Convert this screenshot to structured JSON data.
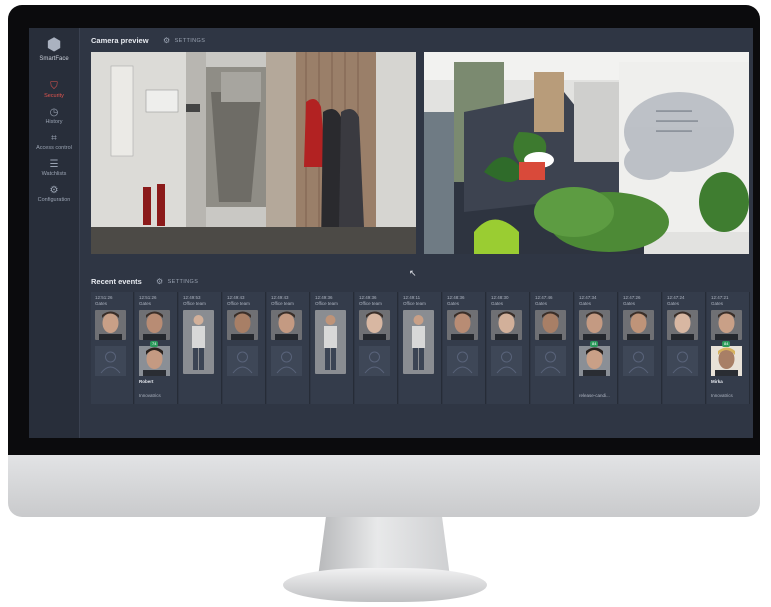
{
  "app": {
    "logo_text": "SmartFace",
    "logo_icon": "hexagon-dots-icon"
  },
  "sidebar": {
    "items": [
      {
        "label": "Security",
        "icon": "shield-icon",
        "active": true
      },
      {
        "label": "History",
        "icon": "history-icon"
      },
      {
        "label": "Access control",
        "icon": "face-scan-icon"
      },
      {
        "label": "Watchlists",
        "icon": "list-icon"
      },
      {
        "label": "Configuration",
        "icon": "gear-icon"
      }
    ]
  },
  "camera_preview": {
    "title": "Camera preview",
    "settings_label": "SETTINGS"
  },
  "recent_events": {
    "title": "Recent events",
    "settings_label": "SETTINGS",
    "events": [
      {
        "time": "12:51:26",
        "zone": "Gates"
      },
      {
        "time": "12:51:26",
        "zone": "Gates",
        "badge": "74",
        "match_name": "Robert",
        "watchlist": "Innovatrics"
      },
      {
        "time": "12:49:53",
        "zone": "Office team"
      },
      {
        "time": "12:49:43",
        "zone": "Office team"
      },
      {
        "time": "12:49:43",
        "zone": "Office team"
      },
      {
        "time": "12:49:36",
        "zone": "Office team"
      },
      {
        "time": "12:49:36",
        "zone": "Office team"
      },
      {
        "time": "12:49:11",
        "zone": "Office team"
      },
      {
        "time": "12:48:36",
        "zone": "Gates"
      },
      {
        "time": "12:48:30",
        "zone": "Gates"
      },
      {
        "time": "12:47:46",
        "zone": "Gates"
      },
      {
        "time": "12:47:34",
        "zone": "Gates",
        "badge": "84",
        "watchlist": "release-candi..."
      },
      {
        "time": "12:47:26",
        "zone": "Gates"
      },
      {
        "time": "12:47:24",
        "zone": "Gates"
      },
      {
        "time": "12:47:21",
        "zone": "Gates",
        "badge": "84",
        "match_name": "Mirka",
        "watchlist": "Innovatrics"
      }
    ]
  },
  "colors": {
    "background": "#2f3644",
    "sidebar": "#282e3a",
    "accent": "#e2554f",
    "match_badge": "#2c9b5c"
  }
}
